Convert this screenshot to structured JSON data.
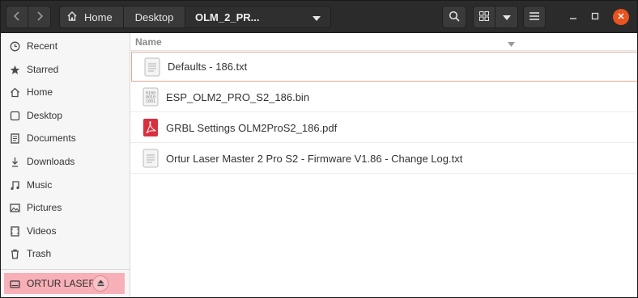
{
  "pathbar": {
    "home_label": "Home",
    "desktop_label": "Desktop",
    "current_label": "OLM_2_PR..."
  },
  "sidebar": {
    "items": [
      {
        "label": "Recent",
        "icon": "clock-icon"
      },
      {
        "label": "Starred",
        "icon": "star-icon"
      },
      {
        "label": "Home",
        "icon": "home-icon"
      },
      {
        "label": "Desktop",
        "icon": "desktop-icon"
      },
      {
        "label": "Documents",
        "icon": "document-icon"
      },
      {
        "label": "Downloads",
        "icon": "download-icon"
      },
      {
        "label": "Music",
        "icon": "music-icon"
      },
      {
        "label": "Pictures",
        "icon": "picture-icon"
      },
      {
        "label": "Videos",
        "icon": "video-icon"
      },
      {
        "label": "Trash",
        "icon": "trash-icon"
      }
    ],
    "device": {
      "label": "ORTUR LASER",
      "icon": "drive-icon"
    }
  },
  "filelist": {
    "column_name": "Name",
    "files": [
      {
        "name": "Defaults - 186.txt",
        "icon": "text-file-icon",
        "selected": true
      },
      {
        "name": "ESP_OLM2_PRO_S2_186.bin",
        "icon": "binary-file-icon",
        "selected": false
      },
      {
        "name": "GRBL Settings OLM2ProS2_186.pdf",
        "icon": "pdf-file-icon",
        "selected": false
      },
      {
        "name": "Ortur Laser Master 2 Pro S2 - Firmware V1.86 - Change Log.txt",
        "icon": "text-file-icon",
        "selected": false
      }
    ]
  },
  "colors": {
    "accent": "#e95420",
    "selection_border": "#e8a58f",
    "device_highlight": "#f7b0b7",
    "pdf_red": "#d9303e"
  }
}
